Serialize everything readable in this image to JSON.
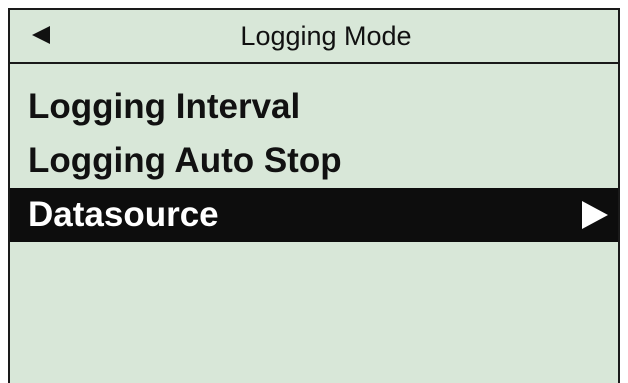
{
  "header": {
    "back_icon": "back-arrow-icon",
    "title": "Logging Mode"
  },
  "menu": {
    "items": [
      {
        "label": "Logging Interval",
        "selected": false
      },
      {
        "label": "Logging Auto Stop",
        "selected": false
      },
      {
        "label": "Datasource",
        "selected": true,
        "icon": "submenu-arrow-icon"
      }
    ]
  },
  "colors": {
    "screen_background": "#d8e7d8",
    "text": "#111111",
    "selection_background": "#0d0d0d",
    "selection_text": "#ffffff"
  }
}
